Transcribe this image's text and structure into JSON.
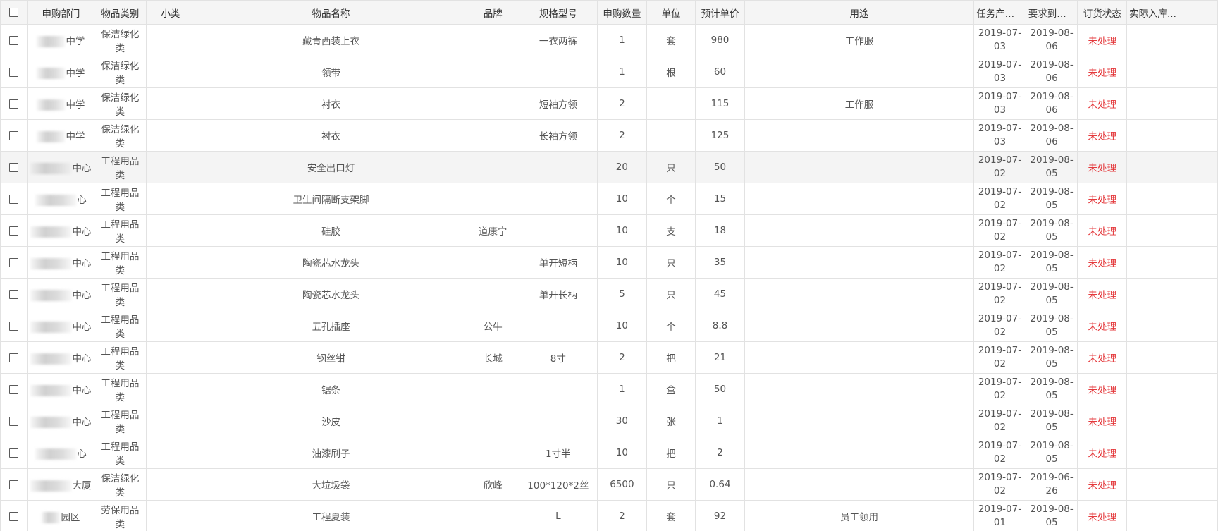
{
  "columns": {
    "dept": "申购部门",
    "category": "物品类别",
    "subcategory": "小类",
    "name": "物品名称",
    "brand": "品牌",
    "spec": "规格型号",
    "qty": "申购数量",
    "unit": "单位",
    "price": "预计单价",
    "purpose": "用途",
    "created": "任务产生...",
    "required": "要求到货...",
    "status": "订货状态",
    "stocked": "实际入库..."
  },
  "rows": [
    {
      "dept": "中学",
      "category": "保洁绿化类",
      "subcategory": "",
      "name": "藏青西装上衣",
      "brand": "",
      "spec": "一衣两裤",
      "qty": "1",
      "unit": "套",
      "price": "980",
      "purpose": "工作服",
      "created": "2019-07-03",
      "required": "2019-08-06",
      "status": "未处理",
      "stocked": ""
    },
    {
      "dept": "中学",
      "category": "保洁绿化类",
      "subcategory": "",
      "name": "领带",
      "brand": "",
      "spec": "",
      "qty": "1",
      "unit": "根",
      "price": "60",
      "purpose": "",
      "created": "2019-07-03",
      "required": "2019-08-06",
      "status": "未处理",
      "stocked": ""
    },
    {
      "dept": "中学",
      "category": "保洁绿化类",
      "subcategory": "",
      "name": "衬衣",
      "brand": "",
      "spec": "短袖方领",
      "qty": "2",
      "unit": "",
      "price": "115",
      "purpose": "工作服",
      "created": "2019-07-03",
      "required": "2019-08-06",
      "status": "未处理",
      "stocked": ""
    },
    {
      "dept": "中学",
      "category": "保洁绿化类",
      "subcategory": "",
      "name": "衬衣",
      "brand": "",
      "spec": "长袖方领",
      "qty": "2",
      "unit": "",
      "price": "125",
      "purpose": "",
      "created": "2019-07-03",
      "required": "2019-08-06",
      "status": "未处理",
      "stocked": ""
    },
    {
      "dept": "中心",
      "category": "工程用品类",
      "subcategory": "",
      "name": "安全出口灯",
      "brand": "",
      "spec": "",
      "qty": "20",
      "unit": "只",
      "price": "50",
      "purpose": "",
      "created": "2019-07-02",
      "required": "2019-08-05",
      "status": "未处理",
      "stocked": ""
    },
    {
      "dept": "心",
      "category": "工程用品类",
      "subcategory": "",
      "name": "卫生间隔断支架脚",
      "brand": "",
      "spec": "",
      "qty": "10",
      "unit": "个",
      "price": "15",
      "purpose": "",
      "created": "2019-07-02",
      "required": "2019-08-05",
      "status": "未处理",
      "stocked": ""
    },
    {
      "dept": "中心",
      "category": "工程用品类",
      "subcategory": "",
      "name": "硅胶",
      "brand": "道康宁",
      "spec": "",
      "qty": "10",
      "unit": "支",
      "price": "18",
      "purpose": "",
      "created": "2019-07-02",
      "required": "2019-08-05",
      "status": "未处理",
      "stocked": ""
    },
    {
      "dept": "中心",
      "category": "工程用品类",
      "subcategory": "",
      "name": "陶瓷芯水龙头",
      "brand": "",
      "spec": "单开短柄",
      "qty": "10",
      "unit": "只",
      "price": "35",
      "purpose": "",
      "created": "2019-07-02",
      "required": "2019-08-05",
      "status": "未处理",
      "stocked": ""
    },
    {
      "dept": "中心",
      "category": "工程用品类",
      "subcategory": "",
      "name": "陶瓷芯水龙头",
      "brand": "",
      "spec": "单开长柄",
      "qty": "5",
      "unit": "只",
      "price": "45",
      "purpose": "",
      "created": "2019-07-02",
      "required": "2019-08-05",
      "status": "未处理",
      "stocked": ""
    },
    {
      "dept": "中心",
      "category": "工程用品类",
      "subcategory": "",
      "name": "五孔插座",
      "brand": "公牛",
      "spec": "",
      "qty": "10",
      "unit": "个",
      "price": "8.8",
      "purpose": "",
      "created": "2019-07-02",
      "required": "2019-08-05",
      "status": "未处理",
      "stocked": ""
    },
    {
      "dept": "中心",
      "category": "工程用品类",
      "subcategory": "",
      "name": "钢丝钳",
      "brand": "长城",
      "spec": "8寸",
      "qty": "2",
      "unit": "把",
      "price": "21",
      "purpose": "",
      "created": "2019-07-02",
      "required": "2019-08-05",
      "status": "未处理",
      "stocked": ""
    },
    {
      "dept": "中心",
      "category": "工程用品类",
      "subcategory": "",
      "name": "锯条",
      "brand": "",
      "spec": "",
      "qty": "1",
      "unit": "盒",
      "price": "50",
      "purpose": "",
      "created": "2019-07-02",
      "required": "2019-08-05",
      "status": "未处理",
      "stocked": ""
    },
    {
      "dept": "中心",
      "category": "工程用品类",
      "subcategory": "",
      "name": "沙皮",
      "brand": "",
      "spec": "",
      "qty": "30",
      "unit": "张",
      "price": "1",
      "purpose": "",
      "created": "2019-07-02",
      "required": "2019-08-05",
      "status": "未处理",
      "stocked": ""
    },
    {
      "dept": "心",
      "category": "工程用品类",
      "subcategory": "",
      "name": "油漆刷子",
      "brand": "",
      "spec": "1寸半",
      "qty": "10",
      "unit": "把",
      "price": "2",
      "purpose": "",
      "created": "2019-07-02",
      "required": "2019-08-05",
      "status": "未处理",
      "stocked": ""
    },
    {
      "dept": "大厦",
      "category": "保洁绿化类",
      "subcategory": "",
      "name": "大垃圾袋",
      "brand": "欣峰",
      "spec": "100*120*2丝",
      "qty": "6500",
      "unit": "只",
      "price": "0.64",
      "purpose": "",
      "created": "2019-07-02",
      "required": "2019-06-26",
      "status": "未处理",
      "stocked": ""
    },
    {
      "dept": "园区",
      "category": "劳保用品类",
      "subcategory": "",
      "name": "工程夏装",
      "brand": "",
      "spec": "L",
      "qty": "2",
      "unit": "套",
      "price": "92",
      "purpose": "员工领用",
      "created": "2019-07-01",
      "required": "2019-08-05",
      "status": "未处理",
      "stocked": ""
    }
  ],
  "icons": {
    "checkbox": "checkbox-icon"
  },
  "colors": {
    "status_unprocessed": "#e4393c",
    "header_bg": "#f5f5f5",
    "border": "#e2e2e2"
  }
}
